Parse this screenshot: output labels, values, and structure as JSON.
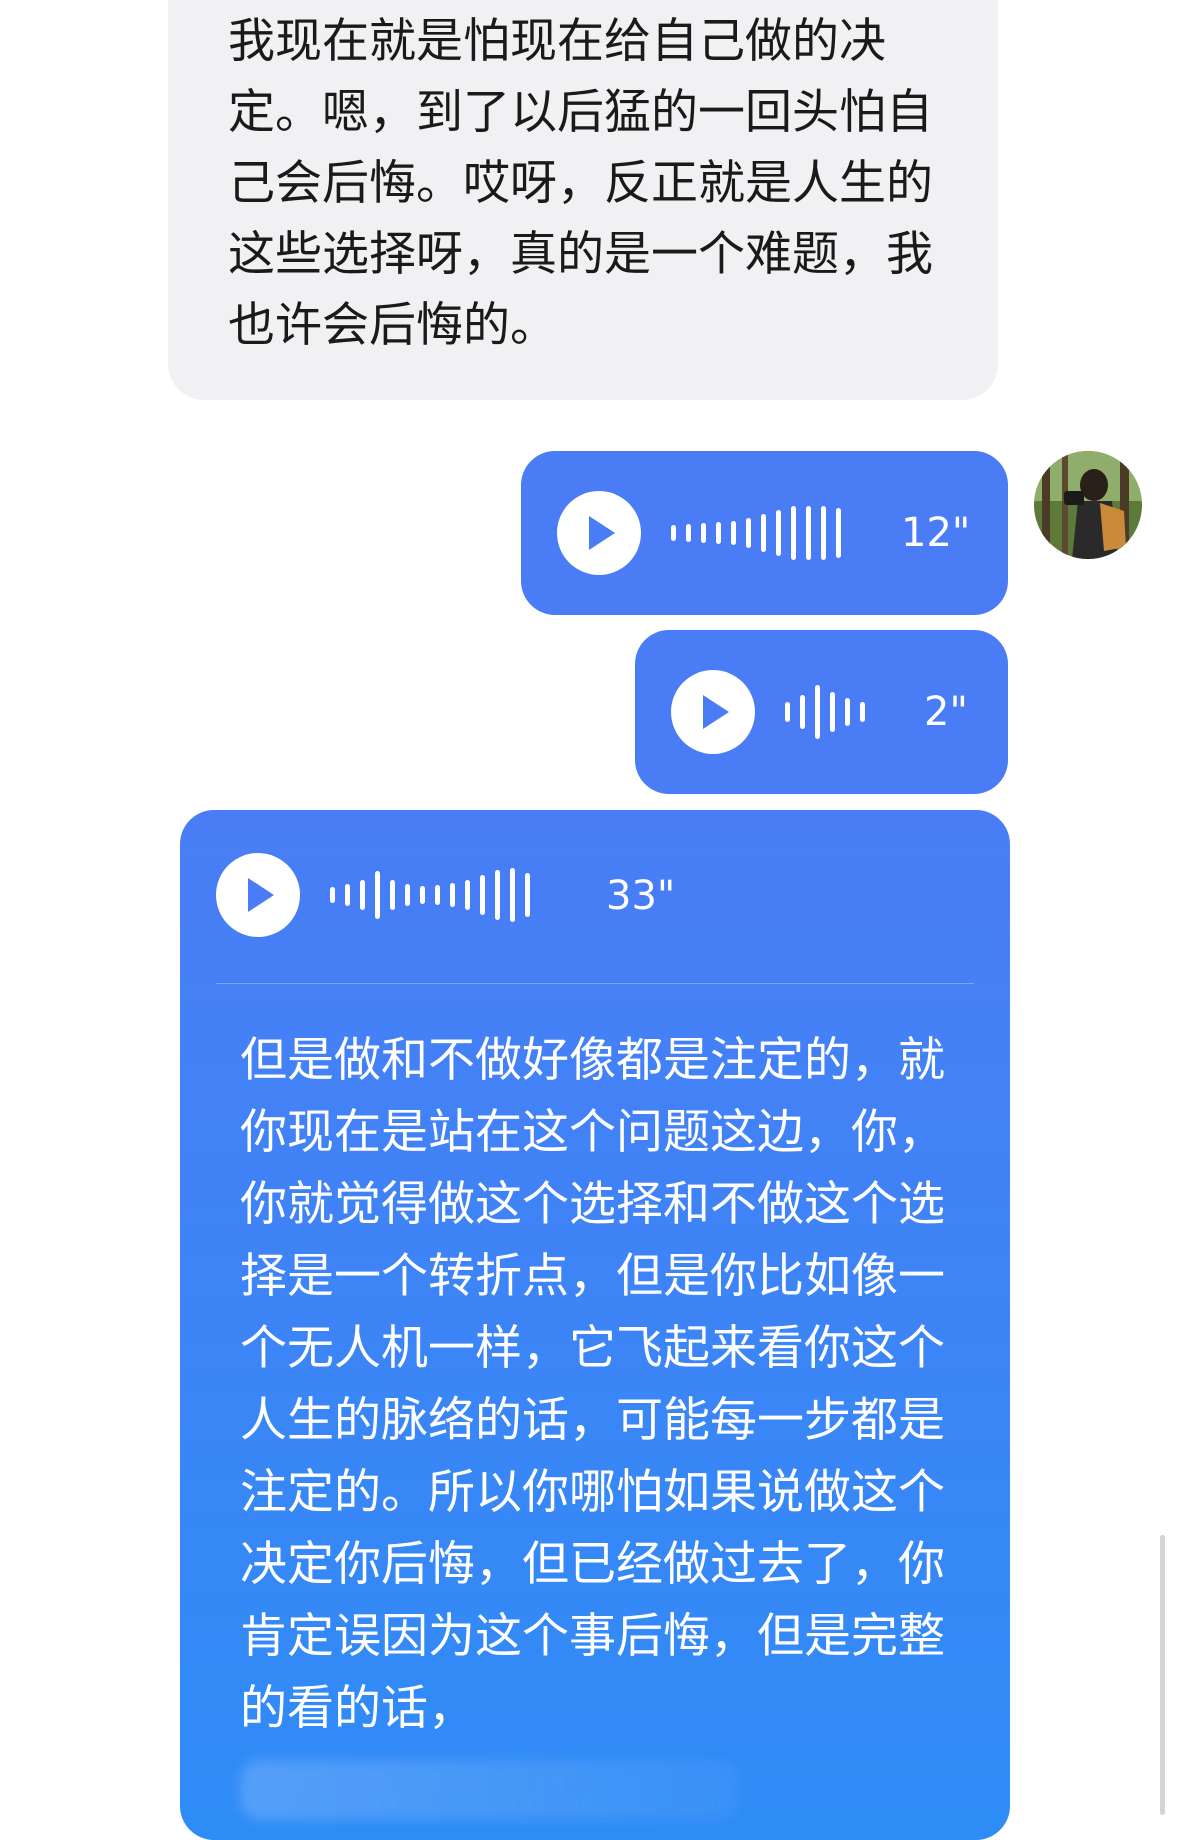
{
  "incoming": {
    "text": "我现在就是怕现在给自己做的决定。嗯，到了以后猛的一回头怕自己会后悔。哎呀，反正就是人生的这些选择呀，真的是一个难题，我也许会后悔的。"
  },
  "outgoing": [
    {
      "duration": "12\""
    },
    {
      "duration": "2\""
    },
    {
      "duration": "33\"",
      "transcript": "但是做和不做好像都是注定的，就你现在是站在这个问题这边，你，你就觉得做这个选择和不做这个选择是一个转折点，但是你比如像一个无人机一样，它飞起来看你这个人生的脉络的话，可能每一步都是注定的。所以你哪怕如果说做这个决定你后悔，但已经做过去了，你肯定误因为这个事后悔，但是完整的看的话，"
    }
  ],
  "colors": {
    "voice_bubble": "#4a7df5",
    "incoming_bubble": "#f1f1f3"
  },
  "icons": [
    "play-icon",
    "waveform-icon",
    "avatar"
  ]
}
